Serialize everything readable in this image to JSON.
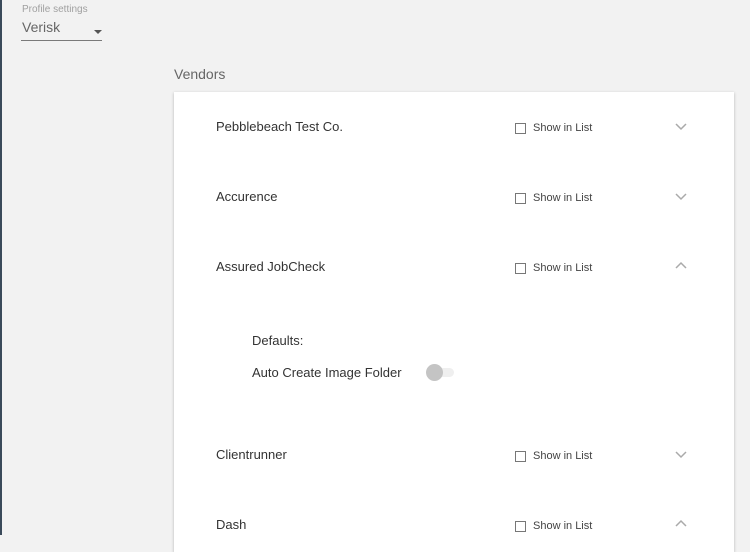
{
  "profile": {
    "label": "Profile settings",
    "selected": "Verisk"
  },
  "vendors_section": {
    "title": "Vendors",
    "show_in_list_label": "Show in List",
    "items": [
      {
        "name": "Pebblebeach Test Co.",
        "show_in_list": false,
        "expanded": false
      },
      {
        "name": "Accurence",
        "show_in_list": false,
        "expanded": false
      },
      {
        "name": "Assured JobCheck",
        "show_in_list": false,
        "expanded": true
      },
      {
        "name": "Clientrunner",
        "show_in_list": false,
        "expanded": false
      },
      {
        "name": "Dash",
        "show_in_list": false,
        "expanded": true
      }
    ],
    "expanded_details": {
      "defaults_label": "Defaults:",
      "auto_create_label": "Auto Create Image Folder",
      "auto_create_enabled": false
    }
  },
  "colors": {
    "background": "#f2f2f2",
    "card": "#ffffff",
    "toggle_knob": "#c4c4c4"
  },
  "icons": [
    "chevron-down-icon",
    "chevron-up-icon",
    "caret-down-icon"
  ]
}
